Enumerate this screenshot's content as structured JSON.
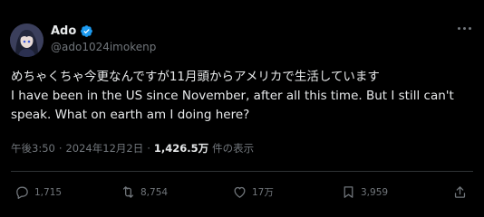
{
  "user": {
    "display_name": "Ado",
    "handle": "@ado1024imokenp",
    "verified": true
  },
  "tweet": {
    "line_jp": "めちゃくちゃ今更なんですが11月頭からアメリカで生活しています",
    "line_en1": "I have been in the US since November, after all this time. But I still can't",
    "line_en2": "speak. What on earth am I doing here?"
  },
  "meta": {
    "time": "午後3:50",
    "separator": "·",
    "date": "2024年12月2日",
    "views": "1,426.5万",
    "views_suffix": "件の表示"
  },
  "actions": {
    "replies": "1,715",
    "reposts": "8,754",
    "likes": "17万",
    "bookmarks": "3,959"
  },
  "colors": {
    "background": "#000000",
    "text": "#e7e9ea",
    "muted": "#71767b",
    "verified": "#1d9bf0",
    "divider": "#2f3336"
  }
}
